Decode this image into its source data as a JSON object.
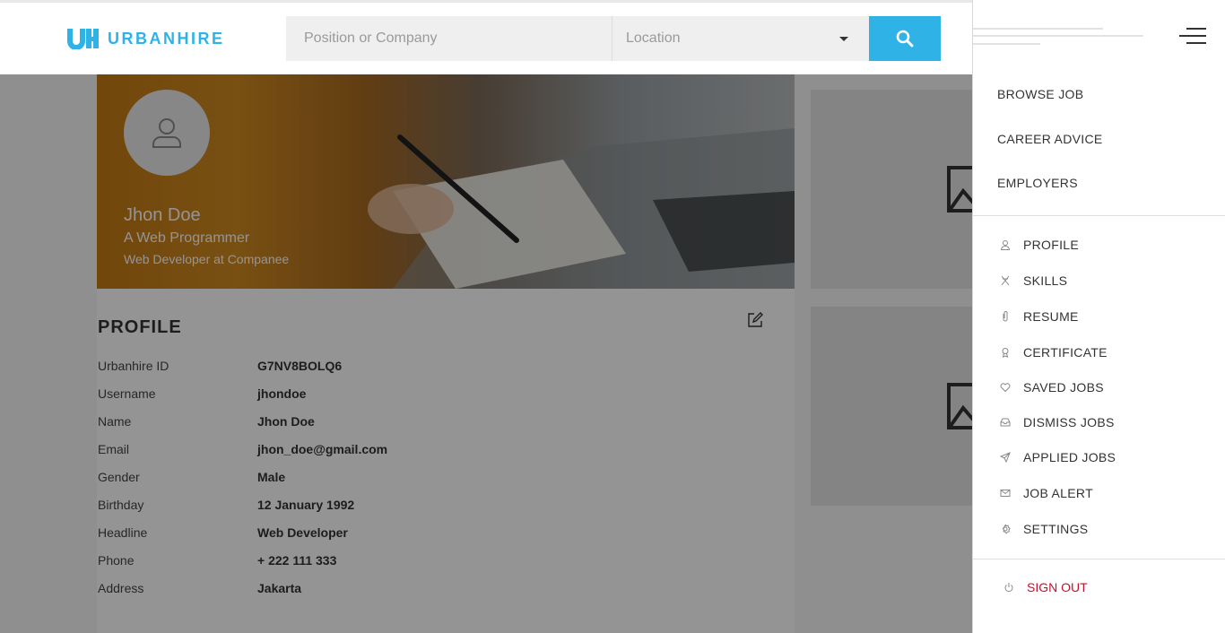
{
  "header": {
    "logo_text": "URBANHIRE",
    "search_placeholder": "Position or Company",
    "location_placeholder": "Location"
  },
  "hero": {
    "name": "Jhon Doe",
    "role": "A Web Programmer",
    "company": "Web Developer at Companee"
  },
  "profile": {
    "title": "PROFILE",
    "rows": [
      {
        "label": "Urbanhire ID",
        "value": "G7NV8BOLQ6"
      },
      {
        "label": "Username",
        "value": "jhondoe"
      },
      {
        "label": "Name",
        "value": "Jhon Doe"
      },
      {
        "label": "Email",
        "value": "jhon_doe@gmail.com"
      },
      {
        "label": "Gender",
        "value": "Male"
      },
      {
        "label": "Birthday",
        "value": "12 January 1992"
      },
      {
        "label": "Headline",
        "value": "Web Developer"
      },
      {
        "label": "Phone",
        "value": "+ 222 111 333"
      },
      {
        "label": "Address",
        "value": "Jakarta"
      }
    ]
  },
  "drawer": {
    "main_links": [
      "BROWSE JOB",
      "CAREER ADVICE",
      "EMPLOYERS"
    ],
    "menu": [
      {
        "label": "PROFILE",
        "icon": "user-icon"
      },
      {
        "label": "SKILLS",
        "icon": "skills-icon"
      },
      {
        "label": "RESUME",
        "icon": "paperclip-icon"
      },
      {
        "label": "CERTIFICATE",
        "icon": "certificate-icon"
      },
      {
        "label": "SAVED JOBS",
        "icon": "heart-icon"
      },
      {
        "label": "DISMISS JOBS",
        "icon": "inbox-icon"
      },
      {
        "label": "APPLIED JOBS",
        "icon": "send-icon"
      },
      {
        "label": "JOB ALERT",
        "icon": "mail-icon"
      },
      {
        "label": "SETTINGS",
        "icon": "gear-icon"
      }
    ],
    "signout": "SIGN OUT"
  },
  "colors": {
    "brand": "#2fb3e6",
    "signout": "#c8102e"
  }
}
